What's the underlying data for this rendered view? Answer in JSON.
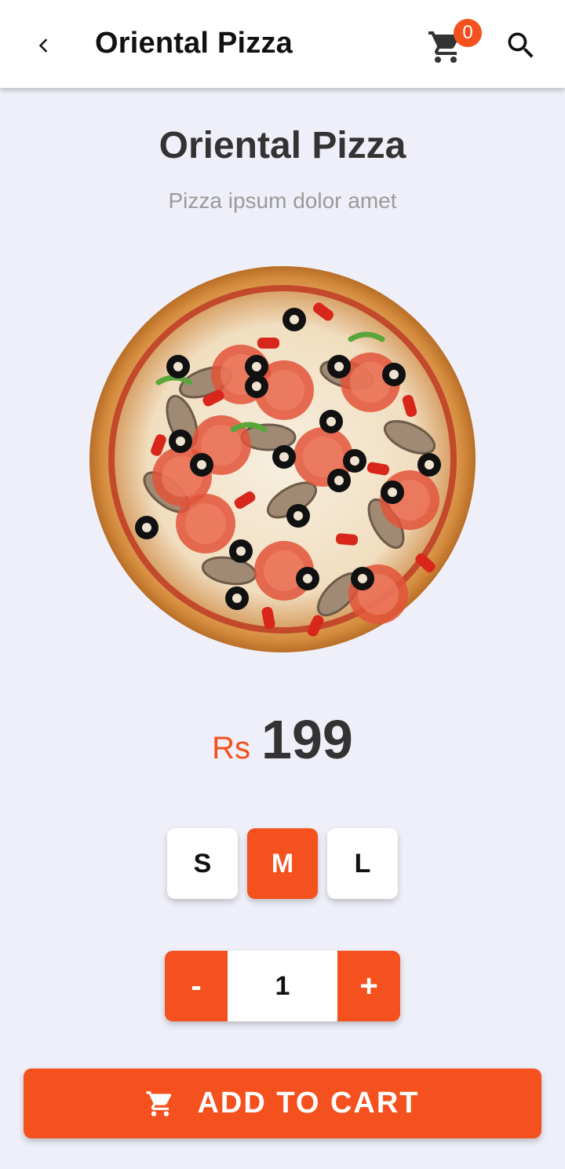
{
  "appbar": {
    "title": "Oriental Pizza",
    "cart_count": "0",
    "icons": {
      "back": "chevron-left-icon",
      "cart": "cart-icon",
      "search": "search-icon"
    }
  },
  "product": {
    "name": "Oriental Pizza",
    "description": "Pizza ipsum dolor amet",
    "image": "pizza-image",
    "currency": "Rs",
    "price": "199"
  },
  "sizes": {
    "options": [
      "S",
      "M",
      "L"
    ],
    "selected": "M"
  },
  "quantity": {
    "decrement_label": "-",
    "value": "1",
    "increment_label": "+"
  },
  "add_to_cart": {
    "label": "ADD TO CART",
    "icon": "cart-icon"
  },
  "colors": {
    "accent": "#f4511e",
    "background": "#eeeff8",
    "text_dark": "#333333",
    "text_muted": "#9a9a9a"
  }
}
